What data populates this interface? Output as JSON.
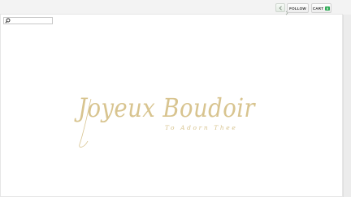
{
  "toolbar": {
    "follow_label": "FOLLOW",
    "cart_label": "CART",
    "cart_count": "0"
  },
  "icons": {
    "nav": "chevron-left-icon",
    "nav_next": "chevron-right-icon",
    "search": "search-icon"
  },
  "search": {
    "placeholder": "",
    "value": ""
  },
  "logo": {
    "title": "Joyeux Boudoir",
    "tagline": "To Adorn Thee",
    "color": "#d8c48f"
  }
}
